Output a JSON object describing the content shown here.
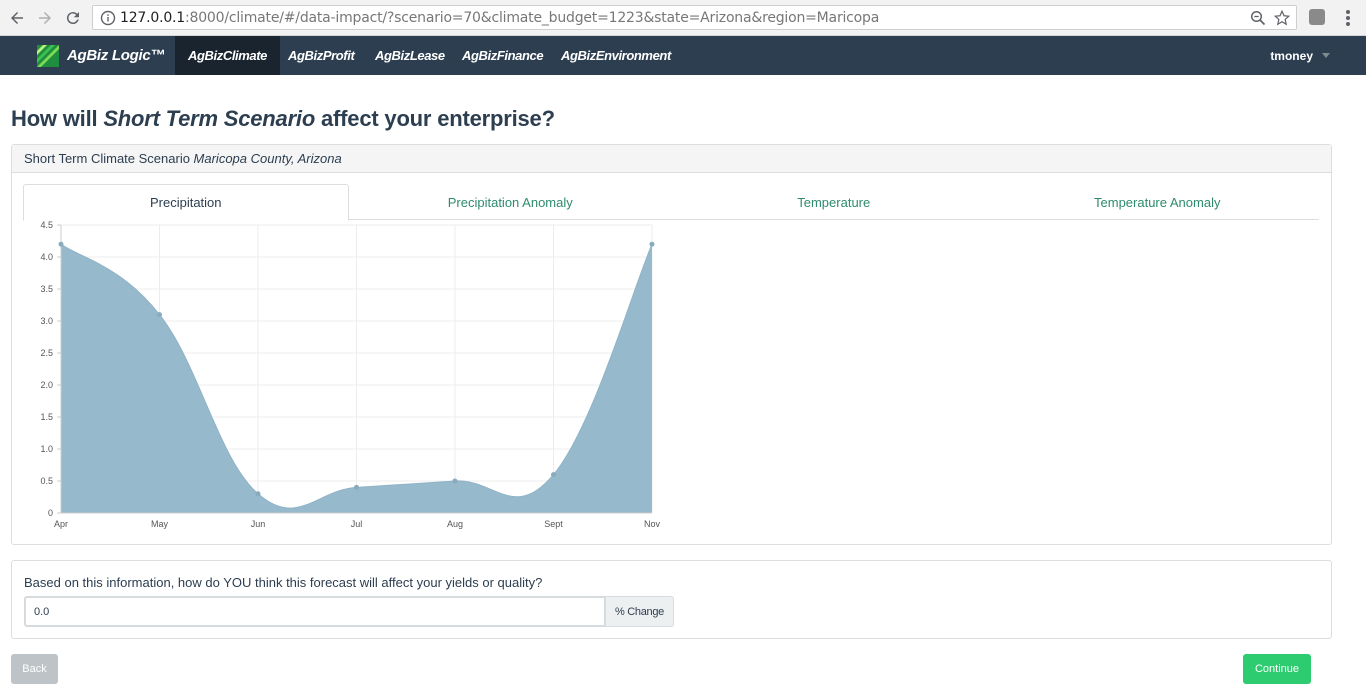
{
  "browser": {
    "url_host": "127.0.0.1",
    "url_rest": ":8000/climate/#/data-impact/?scenario=70&climate_budget=1223&state=Arizona&region=Maricopa"
  },
  "navbar": {
    "brand": "AgBiz Logic™",
    "items": [
      {
        "label": "AgBizClimate",
        "active": true
      },
      {
        "label": "AgBizProfit",
        "active": false
      },
      {
        "label": "AgBizLease",
        "active": false
      },
      {
        "label": "AgBizFinance",
        "active": false
      },
      {
        "label": "AgBizEnvironment",
        "active": false
      }
    ],
    "user": "tmoney"
  },
  "page": {
    "title_prefix": "How will ",
    "title_scenario": "Short Term Scenario",
    "title_suffix": " affect your enterprise?"
  },
  "panel": {
    "heading_prefix": "Short Term Climate Scenario ",
    "heading_location": "Maricopa County, Arizona",
    "tabs": [
      {
        "label": "Precipitation",
        "active": true
      },
      {
        "label": "Precipitation Anomaly",
        "active": false
      },
      {
        "label": "Temperature",
        "active": false
      },
      {
        "label": "Temperature Anomaly",
        "active": false
      }
    ]
  },
  "chart_data": {
    "type": "area",
    "categories": [
      "Apr",
      "May",
      "Jun",
      "Jul",
      "Aug",
      "Sept",
      "Nov"
    ],
    "values": [
      4.2,
      3.1,
      0.3,
      0.4,
      0.5,
      0.6,
      4.2
    ],
    "ylim": [
      0,
      4.5
    ],
    "yticks": [
      "0",
      "0.5",
      "1.0",
      "1.5",
      "2.0",
      "2.5",
      "3.0",
      "3.5",
      "4.0",
      "4.5"
    ],
    "grid": true,
    "fill_color": "#96b9cc",
    "point_color": "#8aaabd"
  },
  "form": {
    "question": "Based on this information, how do YOU think this forecast will affect your yields or quality?",
    "value": "0.0",
    "addon": "% Change"
  },
  "buttons": {
    "back": "Back",
    "continue": "Continue"
  },
  "colors": {
    "navbar": "#2c3e50",
    "tab_link": "#2e8b6e",
    "continue": "#2ecc71",
    "back": "#bdc3c7"
  }
}
